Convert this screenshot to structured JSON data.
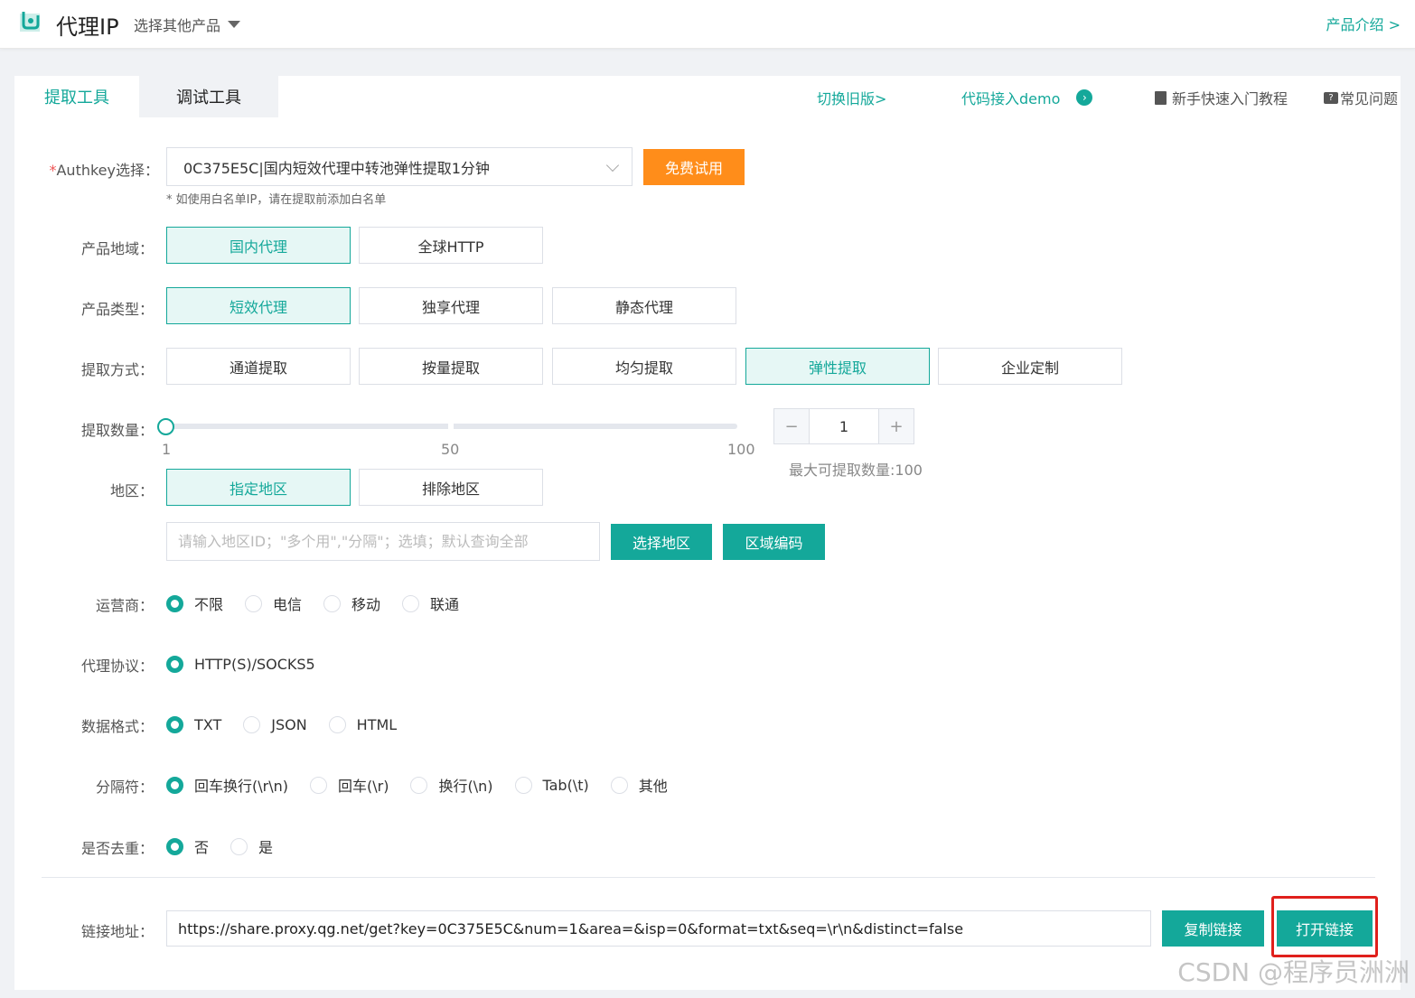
{
  "header": {
    "app_title": "代理IP",
    "product_select": "选择其他产品",
    "intro_link": "产品介绍 >"
  },
  "tabs": [
    {
      "label": "提取工具",
      "active": true
    },
    {
      "label": "调试工具",
      "active": false
    }
  ],
  "top_actions": {
    "switch_old": "切换旧版>",
    "code_demo": "代码接入demo",
    "tutorial": "新手快速入门教程",
    "faq": "常见问题"
  },
  "form": {
    "authkey": {
      "label_req": "*",
      "label": "Authkey选择：",
      "value": "0C375E5C|国内短效代理中转池弹性提取1分钟",
      "trial_button": "免费试用",
      "hint": "* 如使用白名单IP，请在提取前添加白名单"
    },
    "region": {
      "label": "产品地域：",
      "options": [
        "国内代理",
        "全球HTTP"
      ],
      "selected": "国内代理"
    },
    "product_type": {
      "label": "产品类型：",
      "options": [
        "短效代理",
        "独享代理",
        "静态代理"
      ],
      "selected": "短效代理"
    },
    "method": {
      "label": "提取方式：",
      "options": [
        "通道提取",
        "按量提取",
        "均匀提取",
        "弹性提取",
        "企业定制"
      ],
      "selected": "弹性提取"
    },
    "quantity": {
      "label": "提取数量：",
      "slider_marks": [
        "1",
        "50",
        "100"
      ],
      "slider_value": 1,
      "value": "1",
      "minus": "−",
      "plus": "+",
      "max_note": "最大可提取数量:100"
    },
    "area": {
      "label": "地区：",
      "options": [
        "指定地区",
        "排除地区"
      ],
      "selected": "指定地区",
      "placeholder": "请输入地区ID；\"多个用\",\"分隔\"；选填；默认查询全部",
      "select_button": "选择地区",
      "code_button": "区域编码"
    },
    "isp": {
      "label": "运营商：",
      "options": [
        "不限",
        "电信",
        "移动",
        "联通"
      ],
      "selected": "不限"
    },
    "protocol": {
      "label": "代理协议：",
      "options": [
        "HTTP(S)/SOCKS5"
      ],
      "selected": "HTTP(S)/SOCKS5"
    },
    "format": {
      "label": "数据格式：",
      "options": [
        "TXT",
        "JSON",
        "HTML"
      ],
      "selected": "TXT"
    },
    "separator": {
      "label": "分隔符：",
      "options": [
        "回车换行(\\r\\n)",
        "回车(\\r)",
        "换行(\\n)",
        "Tab(\\t)",
        "其他"
      ],
      "selected": "回车换行(\\r\\n)"
    },
    "dedupe": {
      "label": "是否去重：",
      "options": [
        "否",
        "是"
      ],
      "selected": "否"
    },
    "link": {
      "label": "链接地址：",
      "value": "https://share.proxy.qg.net/get?key=0C375E5C&num=1&area=&isp=0&format=txt&seq=\\r\\n&distinct=false",
      "copy_button": "复制链接",
      "open_button": "打开链接"
    }
  },
  "watermark": "CSDN @程序员洲洲",
  "colors": {
    "accent": "#14a89a",
    "orange": "#ff8d1a",
    "highlight": "#e0201c"
  }
}
